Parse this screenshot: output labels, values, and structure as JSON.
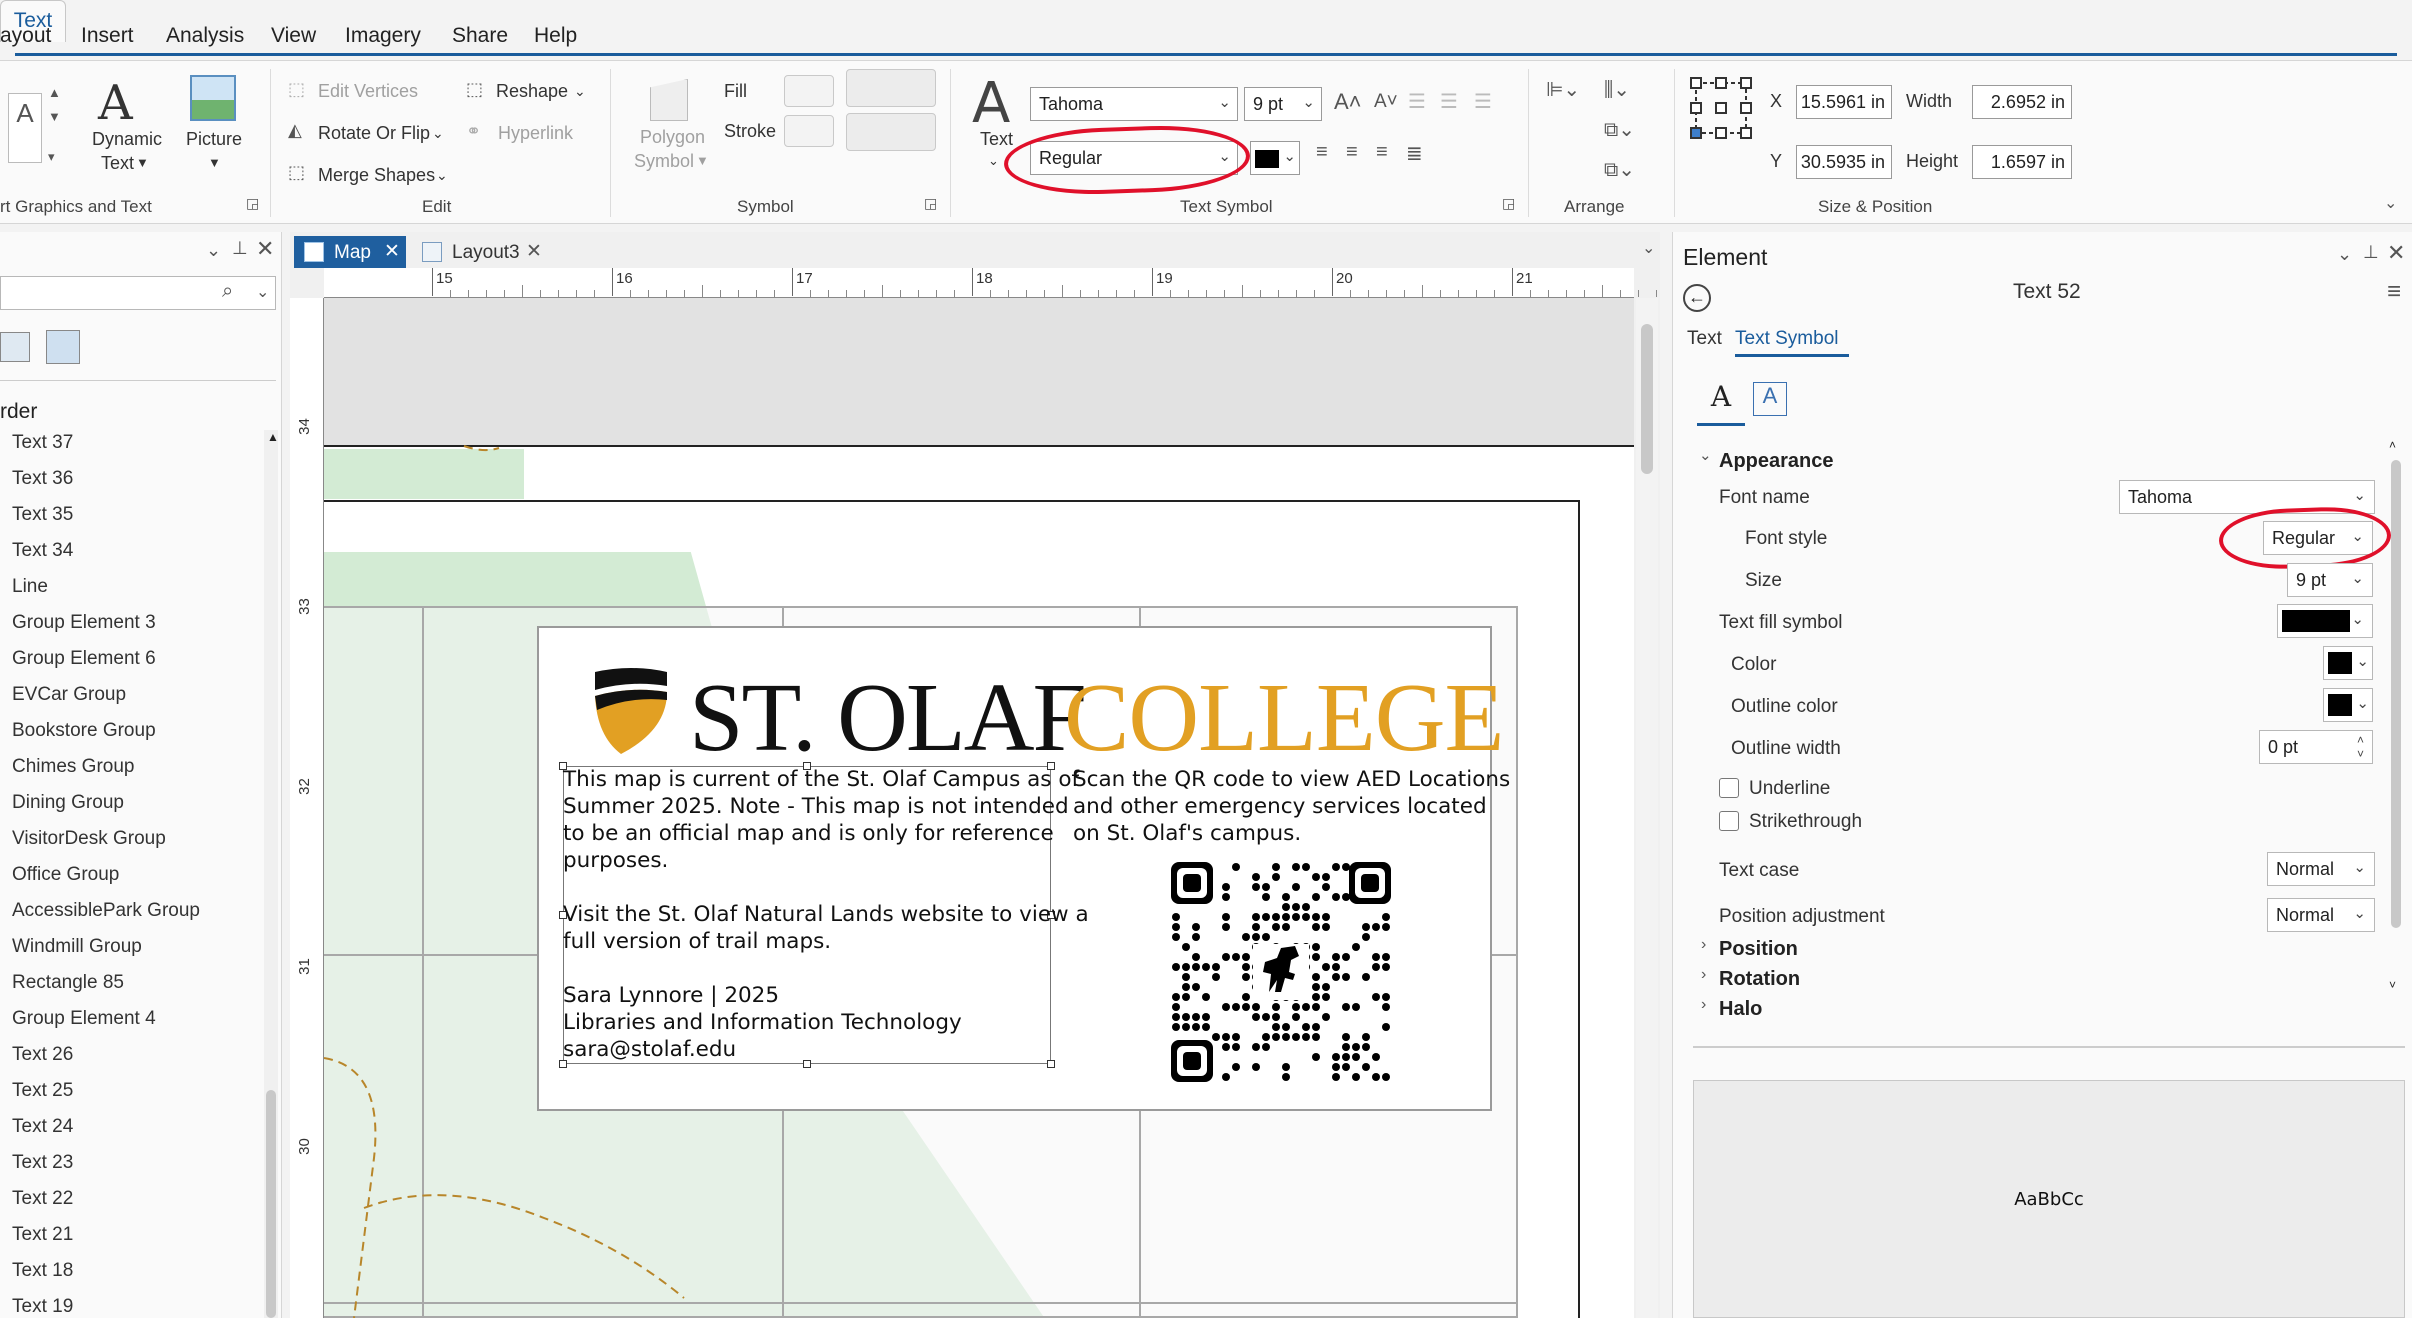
{
  "menu": {
    "items": [
      "ayout",
      "Insert",
      "Analysis",
      "View",
      "Imagery",
      "Share",
      "Help"
    ],
    "active_tab": "Text"
  },
  "ribbon": {
    "insert_group": {
      "dynamic_text_label": "Dynamic",
      "dynamic_text_label2": "Text",
      "picture_label": "Picture",
      "group_label": "rt Graphics and Text"
    },
    "edit_group": {
      "edit_vertices": "Edit Vertices",
      "reshape": "Reshape",
      "rotate_or_flip": "Rotate Or Flip",
      "hyperlink": "Hyperlink",
      "merge_shapes": "Merge Shapes",
      "group_label": "Edit"
    },
    "symbol_group": {
      "polygon_symbol": "Polygon",
      "polygon_symbol2": "Symbol",
      "fill": "Fill",
      "stroke": "Stroke",
      "group_label": "Symbol"
    },
    "text_symbol_group": {
      "text_button": "Text",
      "font_name": "Tahoma",
      "font_size": "9 pt",
      "font_style": "Regular",
      "group_label": "Text Symbol"
    },
    "arrange_group": {
      "group_label": "Arrange"
    },
    "size_position_group": {
      "x_label": "X",
      "x_value": "15.5961 in",
      "y_label": "Y",
      "y_value": "30.5935 in",
      "width_label": "Width",
      "width_value": "2.6952 in",
      "height_label": "Height",
      "height_value": "1.6597 in",
      "group_label": "Size & Position"
    }
  },
  "left_panel": {
    "section_title": "rder",
    "items": [
      "Text 37",
      "Text 36",
      "Text 35",
      "Text 34",
      "Line",
      "Group Element 3",
      "Group Element 6",
      "EVCar Group",
      "Bookstore Group",
      "Chimes Group",
      "Dining Group",
      "VisitorDesk Group",
      "Office Group",
      "AccessiblePark Group",
      "Windmill Group",
      "Rectangle 85",
      "Group Element 4",
      "Text 26",
      "Text 25",
      "Text 24",
      "Text 23",
      "Text 22",
      "Text 21",
      "Text 18",
      "Text 19"
    ]
  },
  "view_tabs": [
    {
      "label": "Map",
      "active": true
    },
    {
      "label": "Layout3",
      "active": false
    }
  ],
  "ruler": {
    "top_numbers": [
      "15",
      "16",
      "17",
      "18",
      "19",
      "20",
      "21"
    ],
    "left_numbers": [
      "34",
      "33",
      "32",
      "31",
      "30"
    ]
  },
  "map_box": {
    "logo_left": "ST. OLAF",
    "logo_right": "COLLEGE",
    "logo_colors": {
      "dark": "#111111",
      "gold": "#e2a023"
    },
    "left_text_lines": [
      "This map is current of the St. Olaf Campus as of",
      "Summer 2025. Note - This map is not intended",
      "to be an official map and is only for reference",
      "purposes.",
      "",
      "Visit the St. Olaf Natural Lands website to view a",
      "full version of trail maps.",
      "",
      "Sara Lynnore | 2025",
      "Libraries and Information Technology",
      "sara@stolaf.edu"
    ],
    "right_text_lines": [
      "Scan the QR code to view AED Locations",
      "and other emergency services located",
      "on St. Olaf's campus."
    ]
  },
  "element_panel": {
    "title": "Element",
    "element_name": "Text 52",
    "tabs": [
      "Text",
      "Text Symbol"
    ],
    "active_tab": "Text Symbol",
    "appearance": {
      "section": "Appearance",
      "font_name_label": "Font name",
      "font_name": "Tahoma",
      "font_style_label": "Font style",
      "font_style": "Regular",
      "size_label": "Size",
      "size": "9 pt",
      "fill_label": "Text fill symbol",
      "color_label": "Color",
      "outline_color_label": "Outline color",
      "outline_width_label": "Outline width",
      "outline_width": "0 pt",
      "underline_label": "Underline",
      "strikethrough_label": "Strikethrough",
      "text_case_label": "Text case",
      "text_case": "Normal",
      "position_adjustment_label": "Position adjustment",
      "position_adjustment": "Normal"
    },
    "collapsed_sections": [
      "Position",
      "Rotation",
      "Halo"
    ],
    "preview_text": "AaBbCc"
  },
  "colors": {
    "accent": "#1a5c9c",
    "annotation_red": "#e0102a",
    "map_green": "#d3ebd4"
  }
}
